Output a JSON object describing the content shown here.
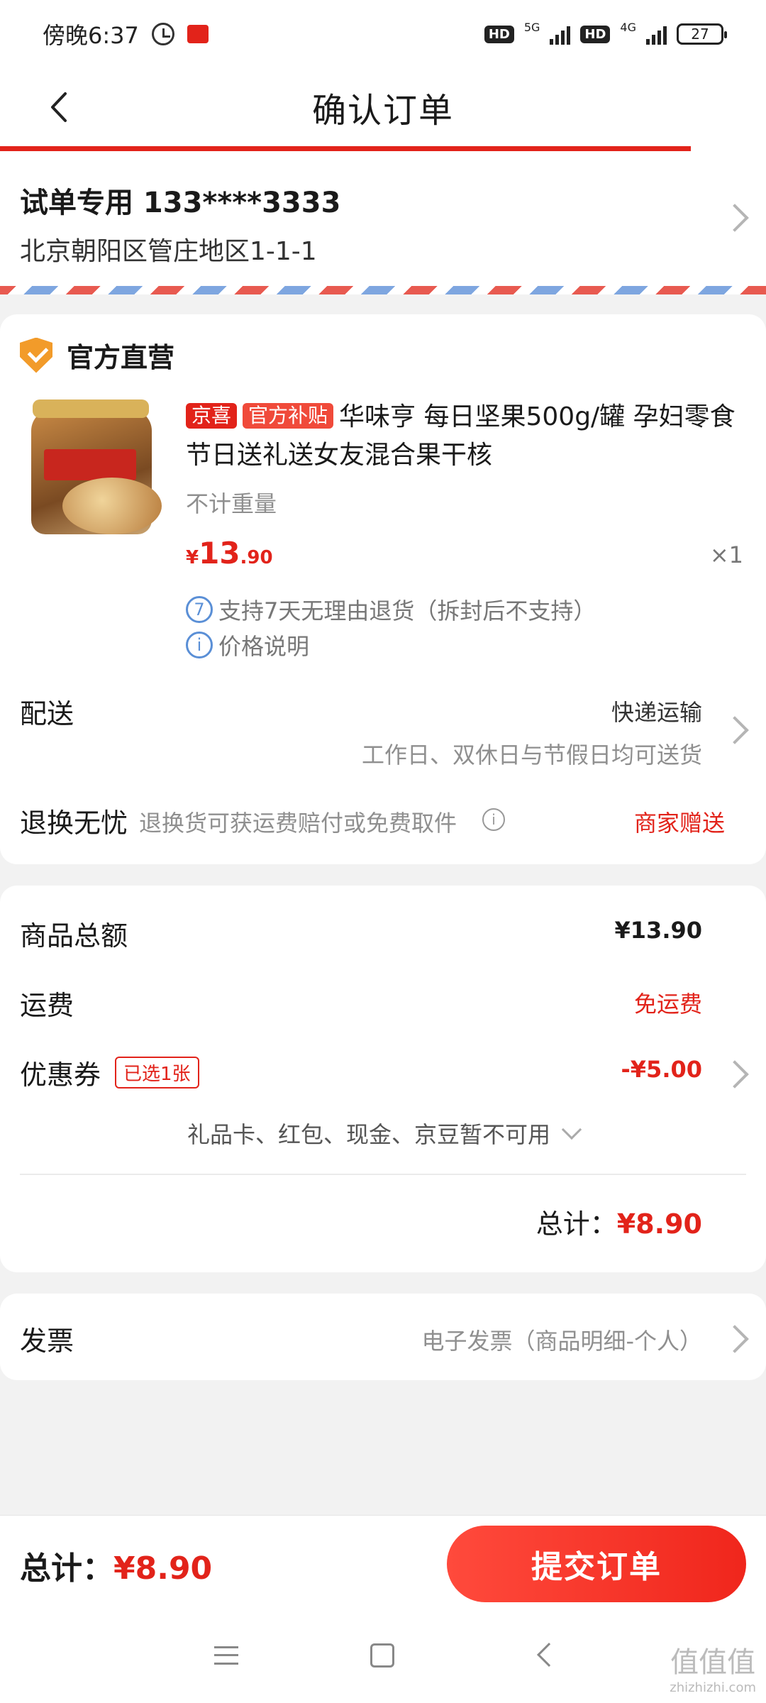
{
  "status": {
    "time": "傍晚6:37",
    "net1": "5G",
    "net2": "4G",
    "hd": "HD",
    "battery": "27"
  },
  "header": {
    "title": "确认订单"
  },
  "address": {
    "name_phone": "试单专用 133****3333",
    "detail": "北京朝阳区管庄地区1-1-1"
  },
  "shop": {
    "name": "官方直营"
  },
  "product": {
    "tag1": "京喜",
    "tag2": "官方补贴",
    "title": "华味亨 每日坚果500g/罐 孕妇零食节日送礼送女友混合果干核",
    "spec": "不计重量",
    "price_symbol": "¥",
    "price_int": "13",
    "price_dec": ".90",
    "qty": "×1",
    "service1_icon": "7",
    "service1": "支持7天无理由退货（拆封后不支持）",
    "service2_icon": "i",
    "service2": "价格说明"
  },
  "delivery": {
    "label": "配送",
    "method": "快递运输",
    "note": "工作日、双休日与节假日均可送货"
  },
  "returns": {
    "label": "退换无忧",
    "desc": "退换货可获运费赔付或免费取件",
    "value": "商家赠送"
  },
  "summary": {
    "goods_label": "商品总额",
    "goods_value": "¥13.90",
    "shipping_label": "运费",
    "shipping_value": "免运费",
    "coupon_label": "优惠券",
    "coupon_badge": "已选1张",
    "coupon_value": "-¥5.00",
    "unavailable": "礼品卡、红包、现金、京豆暂不可用",
    "total_label": "总计：",
    "total_value": "¥8.90"
  },
  "invoice": {
    "label": "发票",
    "value": "电子发票（商品明细-个人）"
  },
  "bottom": {
    "total_label": "总计：",
    "total_value": "¥8.90",
    "submit": "提交订单"
  },
  "watermark": {
    "glyphs": "值值值",
    "site": "zhizhizhi.com"
  },
  "colors": {
    "accent": "#e2231a",
    "shield": "#f29b2a",
    "info_blue": "#5a8fd6"
  }
}
